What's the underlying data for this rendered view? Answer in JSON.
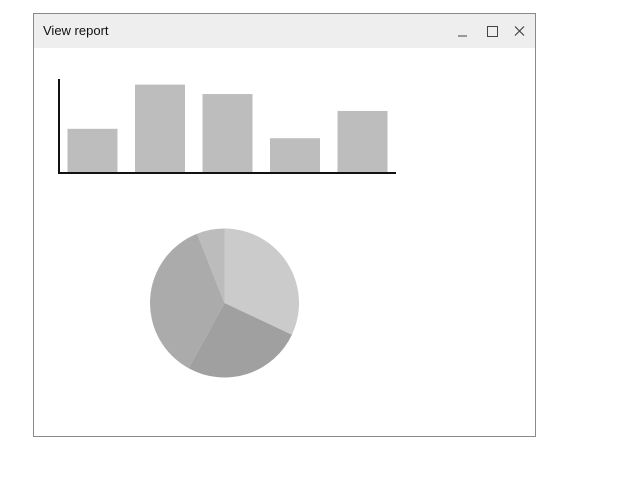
{
  "window": {
    "title": "View report"
  },
  "titlebar": {
    "minimize_icon": "minimize-icon",
    "maximize_icon": "maximize-icon",
    "close_icon": "close-icon"
  },
  "chart_data": [
    {
      "type": "bar",
      "categories": [
        "",
        "",
        "",
        "",
        ""
      ],
      "values": [
        47,
        94,
        84,
        37,
        66
      ],
      "ylim": [
        0,
        100
      ],
      "xlabel": "",
      "ylabel": "",
      "grid": false,
      "bar_color": "#bdbdbd",
      "axis_color": "#111111"
    },
    {
      "type": "pie",
      "labels": [
        "",
        "",
        "",
        ""
      ],
      "values": [
        32,
        26,
        36,
        6
      ],
      "start_angle_deg": 90,
      "direction": "clockwise",
      "colors": [
        "#cbcbcb",
        "#a0a0a0",
        "#ababab",
        "#bcbcbc"
      ]
    }
  ]
}
